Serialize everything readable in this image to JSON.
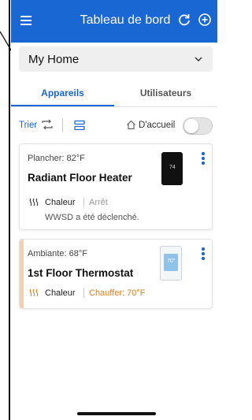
{
  "header": {
    "title": "Tableau de bord",
    "menu_icon": "hamburger-icon",
    "refresh_icon": "refresh-icon",
    "add_icon": "add-circle-icon",
    "bg_color": "#1967d2"
  },
  "home_selector": {
    "value": "My Home",
    "icon": "chevron-down-icon"
  },
  "tabs": [
    {
      "label": "Appareils",
      "active": true
    },
    {
      "label": "Utilisateurs",
      "active": false
    }
  ],
  "toolbar": {
    "sort_label": "Trier",
    "home_filter_label": "D'accueil",
    "home_filter_on": false
  },
  "devices": [
    {
      "sensor": "Plancher: 82°F",
      "name": "Radiant Floor Heater",
      "mode": "Chaleur",
      "state": "Arrêt",
      "note": "WWSD a été déclenché.",
      "display_value": "74"
    },
    {
      "sensor": "Ambiante: 68°F",
      "name": "1st Floor Thermostat",
      "mode": "Chaleur",
      "state": "Chauffer: 70°F",
      "display_value": "70°",
      "accent_color": "#f6cfa8",
      "state_color": "#d9822b"
    }
  ]
}
